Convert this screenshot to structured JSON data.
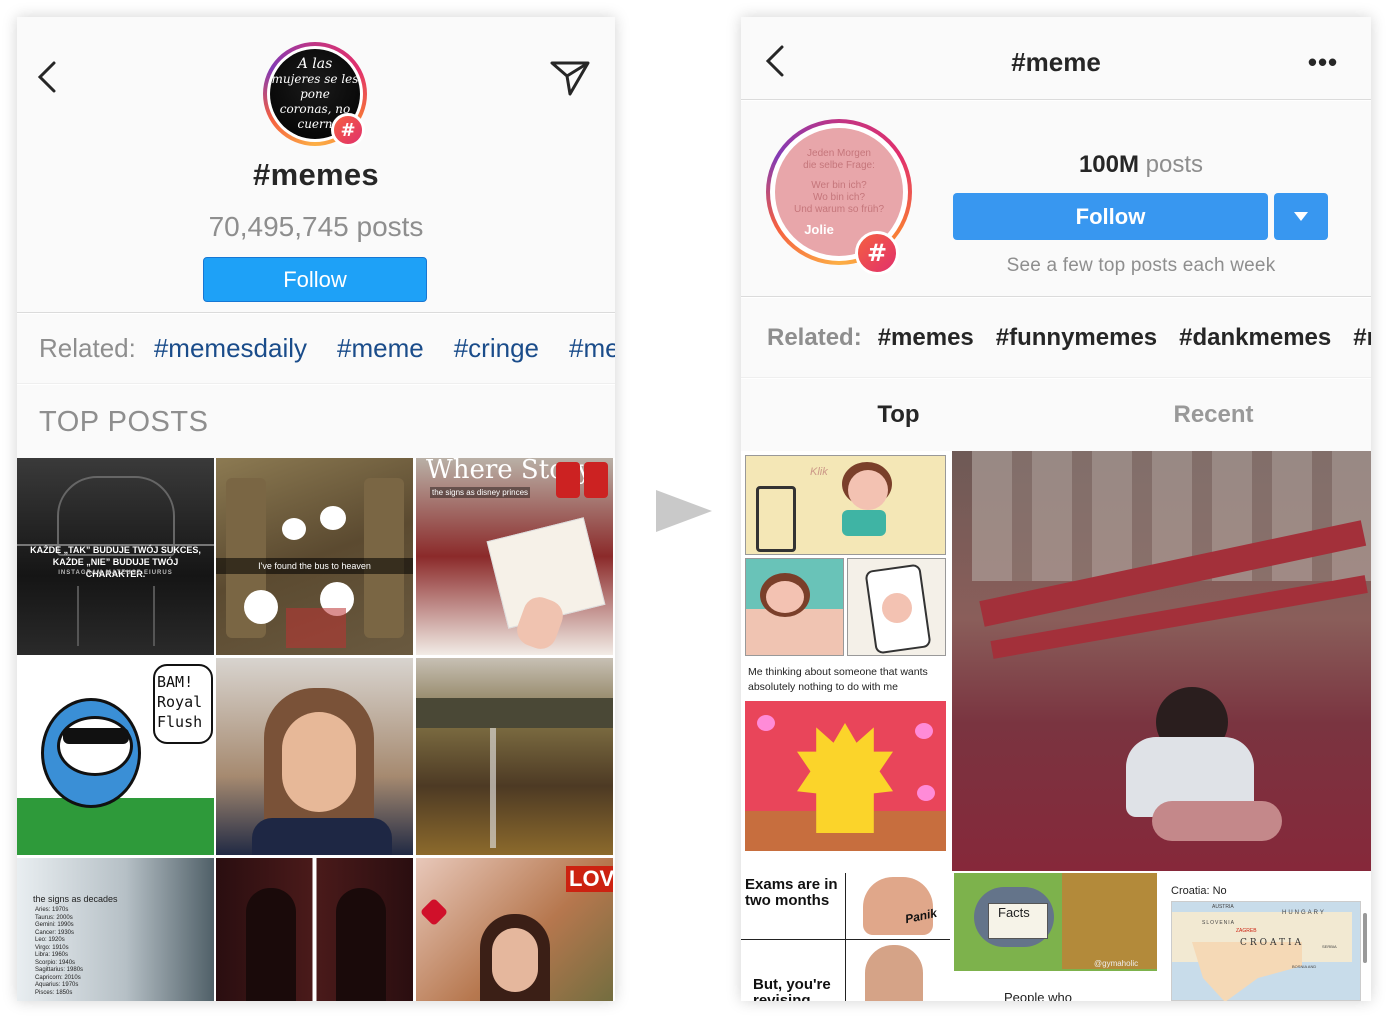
{
  "left": {
    "avatar_text": [
      "A las",
      "mujeres se les",
      "pone",
      "coronas, no",
      "cuern"
    ],
    "hashtag": "#memes",
    "posts": "70,495,745 posts",
    "follow_label": "Follow",
    "related_label": "Related:",
    "related_tags": [
      "#memesdaily",
      "#meme",
      "#cringe",
      "#me"
    ],
    "section_title": "TOP POSTS",
    "posts_captions": {
      "p1": "KAŻDE „TAK” BUDUJE TWÓJ SUKCES, KAŻDE „NIE” BUDUJE TWÓJ CHARAKTER.",
      "p1_sub": "INSTAGRAM  MATEUSZ.EIURUS",
      "p2": "I've found the bus to heaven",
      "p3_big": "Where Story",
      "p3": "the signs as disney princes",
      "p4": "BAM! Royal Flush",
      "p7": "the signs as decades",
      "p7_list": [
        "Aries: 1970s",
        "Taurus: 2000s",
        "Gemini: 1990s",
        "Cancer: 1930s",
        "Leo: 1920s",
        "Virgo: 1910s",
        "Libra: 1960s",
        "Scorpio: 1940s",
        "Sagittarius: 1980s",
        "Capricorn: 2010s",
        "Aquarius: 1970s",
        "Pisces: 1850s"
      ],
      "p9": "LOVE"
    }
  },
  "right": {
    "title": "#meme",
    "more": "•••",
    "avatar_text": [
      "Jeden Morgen",
      "die selbe Frage:",
      "Wer bin ich?",
      "Wo bin ich?",
      "Und warum so früh?",
      "Jolie"
    ],
    "posts_number": "100M",
    "posts_label": " posts",
    "follow_label": "Follow",
    "subtitle": "See a few top posts each week",
    "related_label": "Related:",
    "related_tags": [
      "#memes",
      "#funnymemes",
      "#dankmemes",
      "#r"
    ],
    "tabs": [
      "Top",
      "Recent"
    ],
    "tile_texts": {
      "klik": "Klik",
      "lisa_caption": "Me thinking about someone that wants absolutely nothing to do with me",
      "exams": "Exams are in two months",
      "panik": "Panik",
      "revising": "But, you're revising",
      "facts": "Facts",
      "people_who": "People who",
      "gymaholic": "@gymaholic",
      "croatia": "Croatia: No",
      "map_label": "CROATIA",
      "map_hungary": "HUNGARY",
      "map_slovenia": "SLOVENIA",
      "map_austria": "AUSTRIA",
      "map_bosnia": "BOSNIA AND",
      "map_serbia": "SERBIA",
      "map_zagreb": "ZAGREB"
    }
  }
}
